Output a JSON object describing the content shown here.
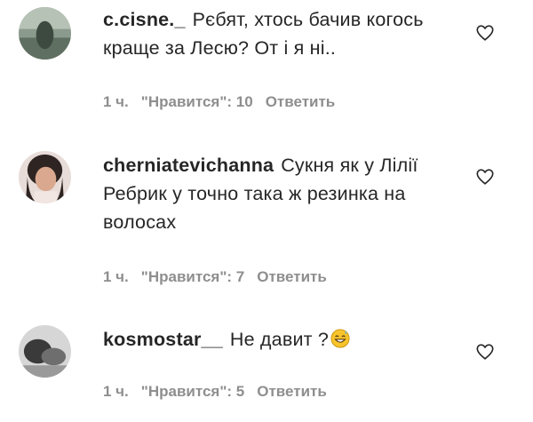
{
  "comments": [
    {
      "username": "c.cisne._",
      "text": "Рєбят, хтось бачив когось краще за Лесю? От і я ні..",
      "time": "1 ч.",
      "likes": "\"Нравится\": 10",
      "reply_label": "Ответить",
      "avatar_icon": "avatar-photo"
    },
    {
      "username": "cherniatevichanna",
      "text": "Сукня як у Лілії Ребрик у точно така ж резинка на волосах",
      "time": "1 ч.",
      "likes": "\"Нравится\": 7",
      "reply_label": "Ответить",
      "avatar_icon": "avatar-photo"
    },
    {
      "username": "kosmostar__",
      "text": "Не давит ?",
      "emoji": "grinning-sweat-emoji",
      "time": "1 ч.",
      "likes": "\"Нравится\": 5",
      "reply_label": "Ответить",
      "avatar_icon": "avatar-photo"
    }
  ],
  "icons": {
    "like": "heart-outline-icon"
  },
  "colors": {
    "text": "#262626",
    "meta": "#8e8e8e"
  }
}
